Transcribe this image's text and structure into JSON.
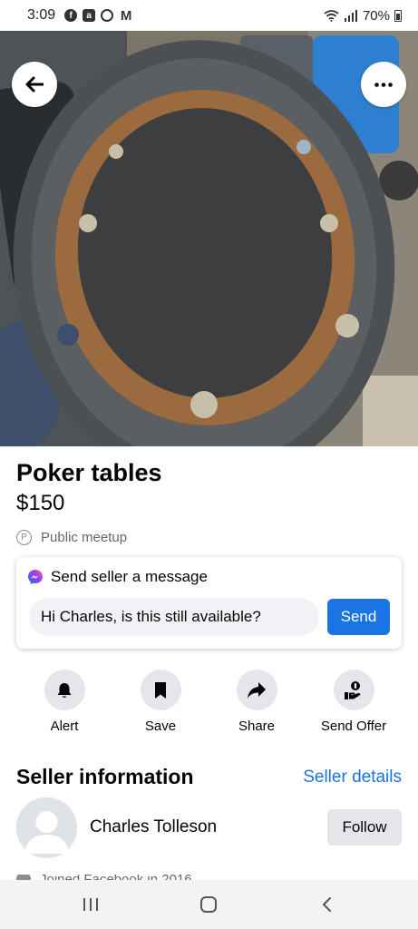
{
  "status": {
    "time": "3:09",
    "battery": "70%",
    "notification_icons": [
      "facebook-icon",
      "app-icon",
      "messenger-icon",
      "gmail-icon"
    ]
  },
  "listing": {
    "title": "Poker tables",
    "price": "$150",
    "meetup": "Public meetup"
  },
  "message": {
    "header": "Send seller a message",
    "input_value": "Hi Charles, is this still available?",
    "send_label": "Send"
  },
  "actions": [
    {
      "label": "Alert",
      "icon": "bell-icon"
    },
    {
      "label": "Save",
      "icon": "bookmark-icon"
    },
    {
      "label": "Share",
      "icon": "share-arrow-icon"
    },
    {
      "label": "Send Offer",
      "icon": "offer-hand-icon"
    }
  ],
  "seller": {
    "heading": "Seller information",
    "details_link": "Seller details",
    "name": "Charles Tolleson",
    "follow_label": "Follow",
    "joined": "Joined Facebook in 2016"
  },
  "colors": {
    "accent": "#1b74e4",
    "button_gray": "#e4e6eb",
    "input_bg": "#f0f2f5",
    "secondary_text": "#65676b"
  }
}
